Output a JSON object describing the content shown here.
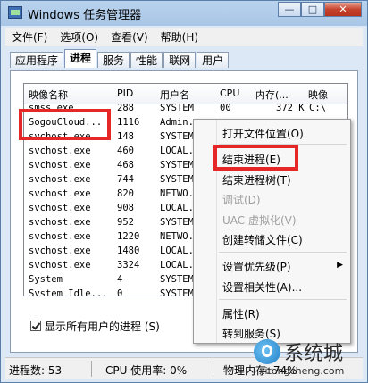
{
  "window": {
    "title": "Windows 任务管理器",
    "controls": [
      "—",
      "□",
      "✕"
    ]
  },
  "menu": [
    "文件(F)",
    "选项(O)",
    "查看(V)",
    "帮助(H)"
  ],
  "tabs": [
    {
      "label": "应用程序",
      "active": false
    },
    {
      "label": "进程",
      "active": true
    },
    {
      "label": "服务",
      "active": false
    },
    {
      "label": "性能",
      "active": false
    },
    {
      "label": "联网",
      "active": false
    },
    {
      "label": "用户",
      "active": false
    }
  ],
  "table": {
    "headers": [
      "映像名称",
      "PID",
      "用户名",
      "CPU",
      "内存(...",
      "映像"
    ],
    "rows": [
      [
        "smss.exe",
        "288",
        "SYSTEM",
        "00",
        "372 K",
        "C:\\"
      ],
      [
        "SogouCloud...",
        "1116",
        "Admin...",
        "",
        "",
        ""
      ],
      [
        "svchost.exe",
        "148",
        "SYSTEM",
        "",
        "",
        ""
      ],
      [
        "svchost.exe",
        "460",
        "LOCAL...",
        "",
        "",
        ""
      ],
      [
        "svchost.exe",
        "468",
        "SYSTEM",
        "",
        "",
        ""
      ],
      [
        "svchost.exe",
        "744",
        "SYSTEM",
        "",
        "",
        ""
      ],
      [
        "svchost.exe",
        "820",
        "NETWO...",
        "",
        "",
        ""
      ],
      [
        "svchost.exe",
        "908",
        "LOCAL...",
        "",
        "",
        ""
      ],
      [
        "svchost.exe",
        "952",
        "SYSTEM",
        "",
        "",
        ""
      ],
      [
        "svchost.exe",
        "1220",
        "NETWO...",
        "",
        "",
        ""
      ],
      [
        "svchost.exe",
        "1480",
        "LOCAL...",
        "",
        "",
        ""
      ],
      [
        "svchost.exe",
        "3324",
        "LOCAL...",
        "",
        "",
        ""
      ],
      [
        "System",
        "4",
        "SYSTEM",
        "",
        "",
        ""
      ],
      [
        "System Idle...",
        "0",
        "SYSTEM",
        "",
        "",
        ""
      ]
    ]
  },
  "show_all_users": {
    "label": "显示所有用户的进程 (S)",
    "checked": true
  },
  "status": {
    "processes": "进程数: 53",
    "cpu": "CPU 使用率: 0%",
    "memory": "物理内存: 74%"
  },
  "context_menu": {
    "items": [
      {
        "label": "打开文件位置(O)",
        "disabled": false
      },
      {
        "label": "结束进程(E)",
        "disabled": false
      },
      {
        "label": "结束进程树(T)",
        "disabled": false
      },
      {
        "label": "调试(D)",
        "disabled": true
      },
      {
        "label": "UAC 虚拟化(V)",
        "disabled": true
      },
      {
        "label": "创建转储文件(C)",
        "disabled": false
      },
      {
        "label": "设置优先级(P)",
        "disabled": false
      },
      {
        "label": "设置相关性(A)...",
        "disabled": false
      },
      {
        "label": "属性(R)",
        "disabled": false
      },
      {
        "label": "转到服务(S)",
        "disabled": false
      }
    ]
  },
  "watermark": {
    "brand": "系统城",
    "url": "xitongcheng.com"
  }
}
